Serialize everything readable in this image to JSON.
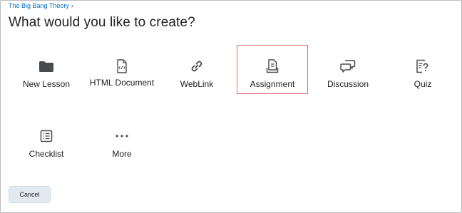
{
  "breadcrumb": {
    "course": "The Big Bang Theory",
    "separator": "›"
  },
  "page_title": "What would you like to create?",
  "tiles": [
    {
      "label": "New Lesson",
      "icon": "folder-icon"
    },
    {
      "label": "HTML Document",
      "icon": "html-file-icon"
    },
    {
      "label": "WebLink",
      "icon": "link-icon"
    },
    {
      "label": "Assignment",
      "icon": "assignment-icon",
      "selected": true
    },
    {
      "label": "Discussion",
      "icon": "discussion-icon"
    },
    {
      "label": "Quiz",
      "icon": "quiz-icon"
    },
    {
      "label": "Checklist",
      "icon": "checklist-icon"
    },
    {
      "label": "More",
      "icon": "more-icon"
    }
  ],
  "footer": {
    "cancel_label": "Cancel"
  },
  "colors": {
    "link": "#006fbf",
    "selected_border": "#e06e6e",
    "button_bg": "#e3e9f1"
  }
}
